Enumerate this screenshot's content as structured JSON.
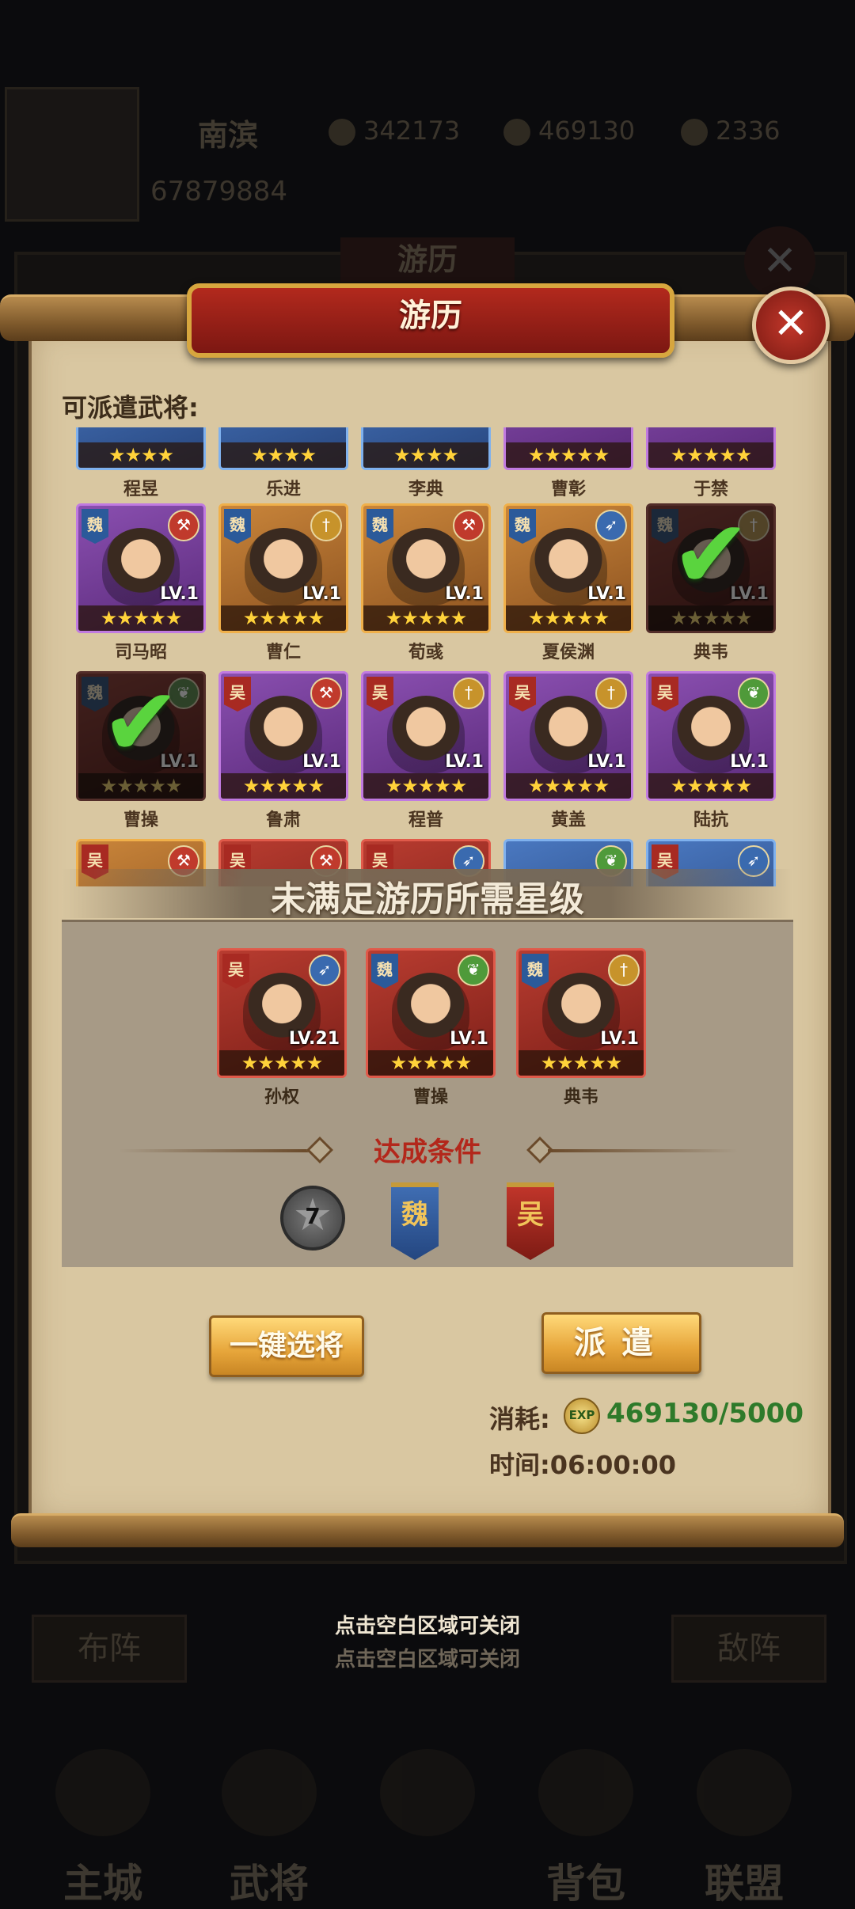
{
  "background": {
    "player_name": "南滨",
    "resources": [
      "342173",
      "469130",
      "2336"
    ],
    "power": "67879884",
    "window_title": "游历",
    "buttons": [
      "布阵",
      "敌阵"
    ],
    "nav": [
      "主城",
      "武将",
      "",
      "背包",
      "联盟"
    ]
  },
  "modal": {
    "title": "游历",
    "close_label": "✕",
    "section_label": "可派遣武将:",
    "heroes_row0": [
      "程昱",
      "乐进",
      "李典",
      "曹彰",
      "于禁"
    ],
    "heroes_row1": [
      {
        "name": "司马昭",
        "faction": "魏",
        "level": "LV.1",
        "stars": "★★★★★"
      },
      {
        "name": "曹仁",
        "faction": "魏",
        "level": "LV.1",
        "stars": "★★★★★"
      },
      {
        "name": "荀彧",
        "faction": "魏",
        "level": "LV.1",
        "stars": "★★★★★"
      },
      {
        "name": "夏侯渊",
        "faction": "魏",
        "level": "LV.1",
        "stars": "★★★★★"
      },
      {
        "name": "典韦",
        "faction": "魏",
        "level": "LV.1",
        "stars": "★★★★★"
      }
    ],
    "heroes_row2": [
      {
        "name": "曹操",
        "faction": "魏",
        "level": "LV.1",
        "stars": "★★★★★"
      },
      {
        "name": "鲁肃",
        "faction": "吴",
        "level": "LV.1",
        "stars": "★★★★★"
      },
      {
        "name": "程普",
        "faction": "吴",
        "level": "LV.1",
        "stars": "★★★★★"
      },
      {
        "name": "黄盖",
        "faction": "吴",
        "level": "LV.1",
        "stars": "★★★★★"
      },
      {
        "name": "陆抗",
        "faction": "吴",
        "level": "LV.1",
        "stars": "★★★★★"
      }
    ],
    "row3_factions": [
      "吴",
      "吴",
      "吴",
      "",
      "吴"
    ],
    "stars4": "★★★★",
    "stars5": "★★★★★",
    "check": "✔",
    "unmet_label": "未满足游历所需星级",
    "unmet_heroes": [
      {
        "name": "孙权",
        "faction": "吴",
        "level": "LV.21",
        "stars": "★★★★★"
      },
      {
        "name": "曹操",
        "faction": "魏",
        "level": "LV.1",
        "stars": "★★★★★"
      },
      {
        "name": "典韦",
        "faction": "魏",
        "level": "LV.1",
        "stars": "★★★★★"
      }
    ],
    "condition_title": "达成条件",
    "condition_star": "7",
    "condition_star_glyph": "★",
    "condition_factions": [
      "魏",
      "吴"
    ],
    "auto_select_label": "一键选将",
    "dispatch_label": "派遣",
    "cost_label": "消耗:",
    "exp_icon_text": "EXP",
    "cost_value": "469130/5000",
    "time_text": "时间:06:00:00"
  },
  "close_hint": "点击空白区域可关闭",
  "colors": {
    "parchment": "#d9c7a1",
    "title_red": "#b2291d",
    "condition_red": "#b3271b",
    "cost_green": "#2e7a2a",
    "gold": "#e6a53a"
  }
}
